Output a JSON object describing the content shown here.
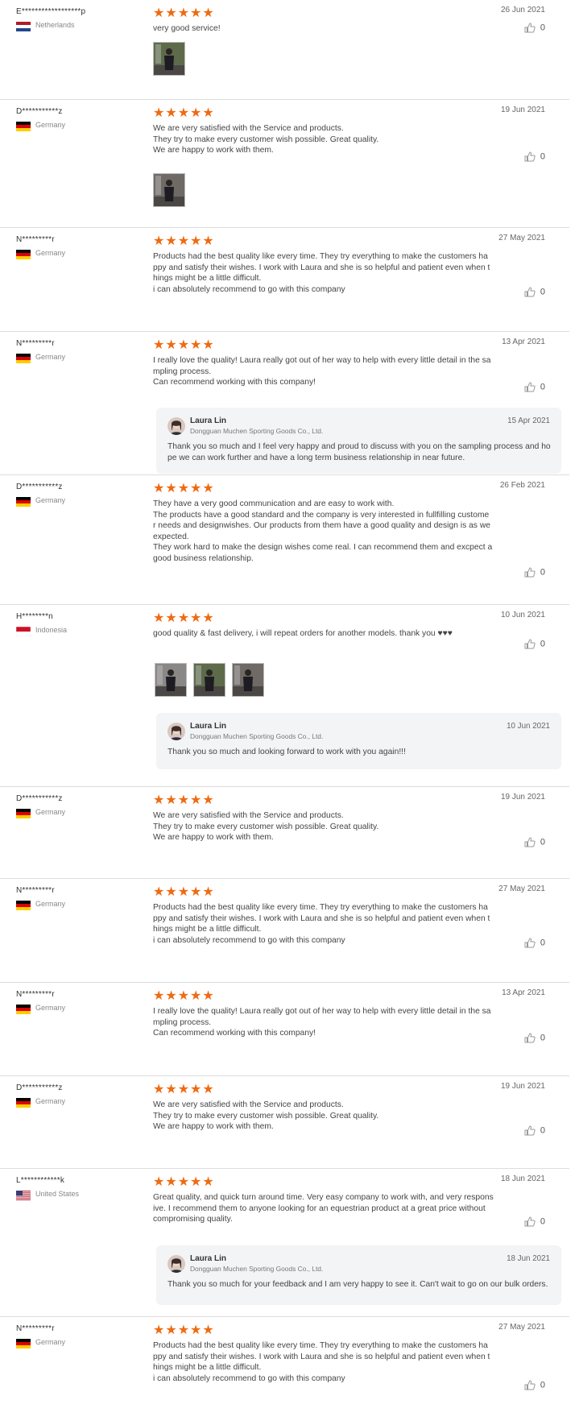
{
  "reviews": [
    {
      "name": "E******************p",
      "country": "Netherlands",
      "flag": "nl",
      "date": "26 Jun 2021",
      "text": [
        "very good service!"
      ],
      "likes": "0",
      "has_images": true,
      "image_count": 1
    },
    {
      "name": "D***********z",
      "country": "Germany",
      "flag": "de",
      "date": "19 Jun 2021",
      "text": [
        "We are very satisfied with the Service and products.",
        "They try to make every customer wish possible. Great quality.",
        "We are happy to work with them."
      ],
      "likes": "0",
      "has_images": true,
      "image_count": 1
    },
    {
      "name": "N*********r",
      "country": "Germany",
      "flag": "de",
      "date": "27 May 2021",
      "text": [
        "Products had the best quality like every time. They try everything to make the customers ha",
        "ppy and satisfy their wishes. I work with Laura and she is so helpful and patient even when t",
        "hings might be a little difficult.",
        "i can absolutely recommend to go with this company"
      ],
      "likes": "0"
    },
    {
      "name": "N*********r",
      "country": "Germany",
      "flag": "de",
      "date": "13 Apr 2021",
      "text": [
        "I really love the quality! Laura really got out of her way to help with every little detail in the sa",
        "mpling process.",
        "Can recommend working with this company!"
      ],
      "likes": "0",
      "reply": {
        "name": "Laura Lin",
        "company": "Dongguan Muchen Sporting Goods Co., Ltd.",
        "date": "15 Apr 2021",
        "text": [
          "Thank you so much and I feel very happy and proud to discuss with you on the sampling process and ho",
          "pe we can work further and have a long term business relationship in near future."
        ]
      }
    },
    {
      "name": "D***********z",
      "country": "Germany",
      "flag": "de",
      "date": "26 Feb 2021",
      "text": [
        "They have a very good communication and are easy to work with.",
        "The products have a good standard and the company is very interested in fullfilling custome",
        "r needs and designwishes. Our products from them have a good quality and design is as we",
        "expected.",
        "They work hard to make the design wishes come real. I can recommend them and excpect a",
        "good business relationship."
      ],
      "likes": "0"
    },
    {
      "name": "H********n",
      "country": "Indonesia",
      "flag": "id",
      "date": "10 Jun 2021",
      "text": [
        "good quality & fast delivery, i will repeat orders for another models. thank you ♥♥♥"
      ],
      "likes": "0",
      "has_images": true,
      "image_count": 3,
      "reply": {
        "name": "Laura Lin",
        "company": "Dongguan Muchen Sporting Goods Co., Ltd.",
        "date": "10 Jun 2021",
        "text": [
          "Thank you so much and looking forward to work with you again!!!"
        ]
      }
    },
    {
      "name": "D***********z",
      "country": "Germany",
      "flag": "de",
      "date": "19 Jun 2021",
      "text": [
        "We are very satisfied with the Service and products.",
        "They try to make every customer wish possible. Great quality.",
        "We are happy to work with them."
      ],
      "likes": "0"
    },
    {
      "name": "N*********r",
      "country": "Germany",
      "flag": "de",
      "date": "27 May 2021",
      "text": [
        "Products had the best quality like every time. They try everything to make the customers ha",
        "ppy and satisfy their wishes. I work with Laura and she is so helpful and patient even when t",
        "hings might be a little difficult.",
        "i can absolutely recommend to go with this company"
      ],
      "likes": "0"
    },
    {
      "name": "N*********r",
      "country": "Germany",
      "flag": "de",
      "date": "13 Apr 2021",
      "text": [
        "I really love the quality! Laura really got out of her way to help with every little detail in the sa",
        "mpling process.",
        "Can recommend working with this company!"
      ],
      "likes": "0"
    },
    {
      "name": "D***********z",
      "country": "Germany",
      "flag": "de",
      "date": "19 Jun 2021",
      "text": [
        "We are very satisfied with the Service and products.",
        "They try to make every customer wish possible. Great quality.",
        "We are happy to work with them."
      ],
      "likes": "0"
    },
    {
      "name": "L************k",
      "country": "United States",
      "flag": "us",
      "date": "18 Jun 2021",
      "text": [
        "Great quality, and quick turn around time. Very easy company to work with, and very respons",
        "ive. I recommend them to anyone looking for an equestrian product at a great price without",
        "compromising quality."
      ],
      "likes": "0",
      "reply": {
        "name": "Laura Lin",
        "company": "Dongguan Muchen Sporting Goods Co., Ltd.",
        "date": "18 Jun 2021",
        "text": [
          "Thank you so much for your feedback and I am very happy to see it. Can't wait to go on our bulk orders."
        ]
      }
    },
    {
      "name": "N*********r",
      "country": "Germany",
      "flag": "de",
      "date": "27 May 2021",
      "text": [
        "Products had the best quality like every time. They try everything to make the customers ha",
        "ppy and satisfy their wishes. I work with Laura and she is so helpful and patient even when t",
        "hings might be a little difficult.",
        "i can absolutely recommend to go with this company"
      ],
      "likes": "0"
    }
  ],
  "colors": {
    "star": "#ef6a12",
    "reply_bg": "#f3f4f6",
    "divider": "#dddddd"
  },
  "icons": {
    "like": "thumbs-up-icon",
    "star": "star-icon"
  }
}
